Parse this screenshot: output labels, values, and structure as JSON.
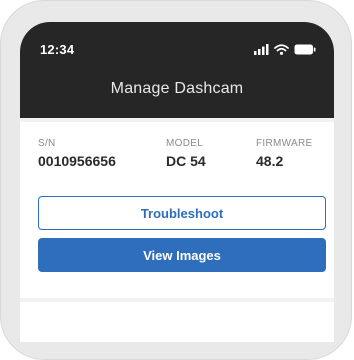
{
  "status_bar": {
    "time": "12:34",
    "icons": [
      "signal-icon",
      "wifi-icon",
      "battery-icon"
    ]
  },
  "header": {
    "title": "Manage Dashcam"
  },
  "device_info": {
    "serial": {
      "label": "S/N",
      "value": "0010956656"
    },
    "model": {
      "label": "MODEL",
      "value": "DC 54"
    },
    "firmware": {
      "label": "FIRMWARE",
      "value": "48.2"
    }
  },
  "actions": {
    "troubleshoot_label": "Troubleshoot",
    "view_images_label": "View Images"
  },
  "colors": {
    "header_bg": "#262626",
    "accent": "#2f6ebd",
    "page_bg": "#f2f2f2",
    "bezel": "#e9e9e9"
  }
}
